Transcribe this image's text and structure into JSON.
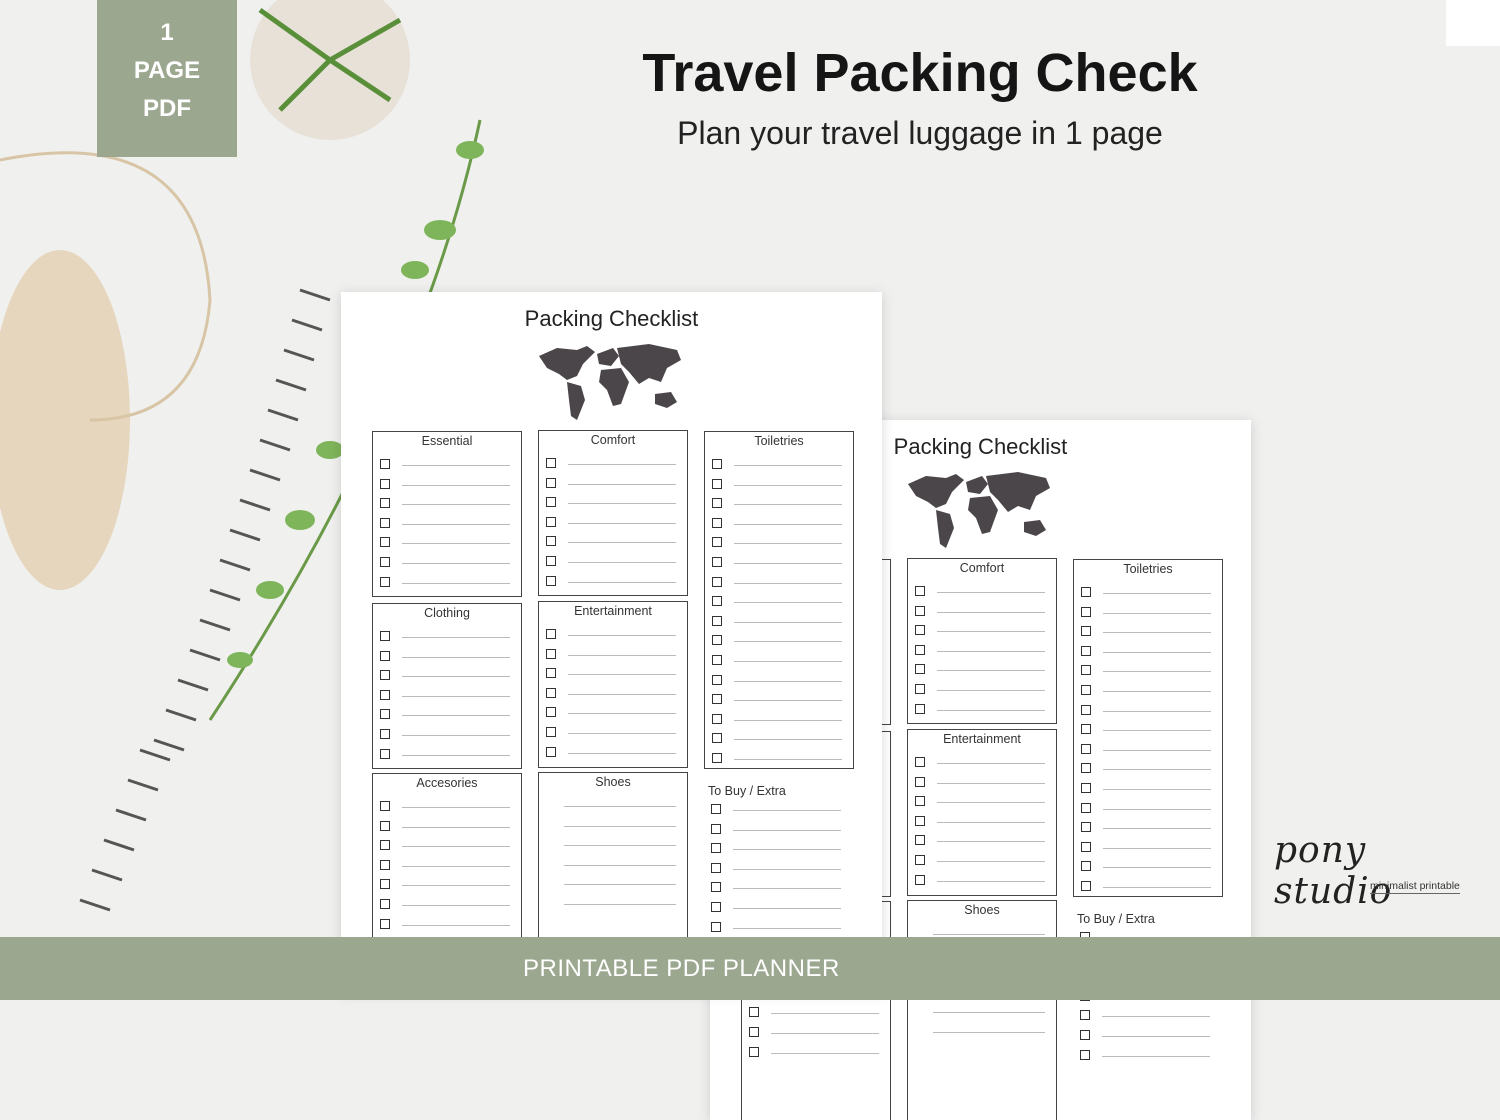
{
  "badge": {
    "lines": [
      "1",
      "PAGE",
      "PDF"
    ]
  },
  "header": {
    "title": "Travel Packing Check",
    "subtitle": "Plan your travel luggage in 1 page"
  },
  "sheet": {
    "title": "Packing Checklist",
    "map_icon": "world-map-icon",
    "sections": [
      {
        "title": "Essential",
        "rows": 7,
        "boxed": true,
        "checkboxes": true
      },
      {
        "title": "Clothing",
        "rows": 7,
        "boxed": true,
        "checkboxes": true
      },
      {
        "title": "Accesories",
        "rows": 7,
        "boxed": true,
        "checkboxes": true
      },
      {
        "title": "Comfort",
        "rows": 7,
        "boxed": true,
        "checkboxes": true
      },
      {
        "title": "Entertainment",
        "rows": 7,
        "boxed": true,
        "checkboxes": true
      },
      {
        "title": "Shoes",
        "rows": 6,
        "boxed": true,
        "checkboxes": false
      },
      {
        "title": "Toiletries",
        "rows": 16,
        "boxed": true,
        "checkboxes": true
      },
      {
        "title": "To Buy / Extra",
        "rows": 7,
        "boxed": false,
        "checkboxes": true
      }
    ]
  },
  "brand": {
    "name": "pony studio",
    "tagline": "minimalist printable"
  },
  "footer": {
    "text": "PRINTABLE PDF PLANNER"
  },
  "colors": {
    "accent": "#9ba78f",
    "map": "#4a4649"
  }
}
